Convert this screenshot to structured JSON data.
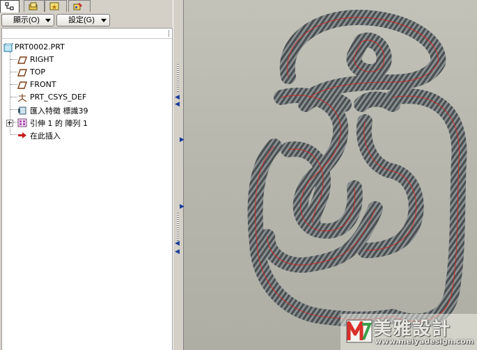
{
  "toolbar": {
    "display_menu": "顯示(O)",
    "settings_menu": "設定(G)"
  },
  "tabs": [
    {
      "icon": "model-tree-icon",
      "active": true
    },
    {
      "icon": "folder-browser-icon",
      "active": false
    },
    {
      "icon": "favorites-icon",
      "active": false
    },
    {
      "icon": "connections-icon",
      "active": false
    }
  ],
  "model_tree": {
    "root": "PRT0002.PRT",
    "items": [
      {
        "label": "RIGHT",
        "icon": "datum-plane-icon"
      },
      {
        "label": "TOP",
        "icon": "datum-plane-icon"
      },
      {
        "label": "FRONT",
        "icon": "datum-plane-icon"
      },
      {
        "label": "PRT_CSYS_DEF",
        "icon": "coordinate-system-icon"
      },
      {
        "label": "匯入特徵 標識39",
        "icon": "import-feature-icon"
      },
      {
        "label": "引伸 1 的 陣列 1",
        "icon": "pattern-icon",
        "expandable": true
      },
      {
        "label": "在此插入",
        "icon": "insert-here-arrow-icon"
      }
    ]
  },
  "watermark": {
    "title": "美雅設計",
    "url": "www.meiyadesign.com"
  },
  "colors": {
    "panel_bg": "#d4d0c8",
    "viewport_bg": "#b9b9af",
    "model_edge": "#e0201a",
    "model_body": "#5c6164"
  }
}
